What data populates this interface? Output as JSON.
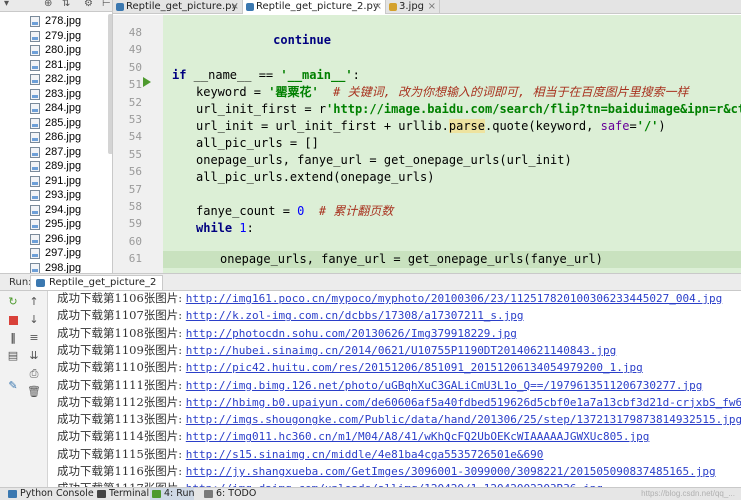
{
  "project": {
    "files": [
      "278.jpg",
      "279.jpg",
      "280.jpg",
      "281.jpg",
      "282.jpg",
      "283.jpg",
      "284.jpg",
      "285.jpg",
      "286.jpg",
      "287.jpg",
      "289.jpg",
      "291.jpg",
      "293.jpg",
      "294.jpg",
      "295.jpg",
      "296.jpg",
      "297.jpg",
      "298.jpg"
    ]
  },
  "tabs": [
    {
      "label": "Reptile_get_picture.py",
      "close": "×",
      "icon": "python-file-icon"
    },
    {
      "label": "Reptile_get_picture_2.py",
      "close": "×",
      "icon": "python-file-icon"
    },
    {
      "label": "3.jpg",
      "close": "×",
      "icon": "image-file-icon"
    }
  ],
  "editor": {
    "line_numbers": [
      "48",
      "49",
      "50",
      "51",
      "52",
      "53",
      "54",
      "55",
      "56",
      "57",
      "58",
      "59",
      "60",
      "61"
    ],
    "line_48": "continue",
    "line_51": {
      "kw1": "if",
      "text1": " __name__ == ",
      "str1": "'__main__'",
      "text2": ":"
    },
    "line_52": {
      "text1": "keyword = ",
      "str1": "'罂粟花'",
      "cmt1": "# 关键词, 改为你想输入的词即可, 相当于在百度图片里搜索一样"
    },
    "line_53": {
      "text1": "url_init_first = r",
      "str1": "'http://image.baidu.com/search/flip?tn=baiduimage&ipn=r&ct=2013265"
    },
    "line_54": {
      "text1": "url_init = url_init_first + urllib.",
      "hl1": "parse",
      "text2": ".quote(keyword, ",
      "prm1": "safe",
      "text3": "=",
      "str1": "'/'",
      "text4": ")"
    },
    "line_55": "all_pic_urls = []",
    "line_56": "onepage_urls, fanye_url = get_onepage_urls(url_init)",
    "line_57": "all_pic_urls.extend(onepage_urls)",
    "line_59": {
      "text1": "fanye_count = ",
      "num1": "0",
      "cmt1": "# 累计翻页数"
    },
    "line_60": {
      "kw1": "while",
      "text1": " ",
      "num1": "1",
      "text2": ":"
    },
    "line_61": "onepage_urls, fanye_url = get_onepage_urls(fanye_url)"
  },
  "run": {
    "label": "Run:",
    "tab": "Reptile_get_picture_2",
    "log": [
      {
        "text": "成功下载第1106张图片: ",
        "url": "http://img161.poco.cn/mypoco/myphoto/20100306/23/1125178201003062334450​27_004.jpg"
      },
      {
        "text": "成功下载第1107张图片: ",
        "url": "http://k.zol-img.com.cn/dcbbs/17308/a17307211_s.jpg"
      },
      {
        "text": "成功下载第1108张图片: ",
        "url": "http://photocdn.sohu.com/20130626/Img379918229.jpg"
      },
      {
        "text": "成功下载第1109张图片: ",
        "url": "http://hubei.sinaimg.cn/2014/0621/U10755P1190DT20140621140843.jpg"
      },
      {
        "text": "成功下载第1110张图片: ",
        "url": "http://pic42.huitu.com/res/20151206/851091_20151206134054979200_1.jpg"
      },
      {
        "text": "成功下载第1111张图片: ",
        "url": "http://img.bimg.126.net/photo/uGBqhXuC3GALiCmU3L1o_Q==/1979613511206730277.jpg"
      },
      {
        "text": "成功下载第1112张图片: ",
        "url": "http://hbimg.b0.upaiyun.com/de60606af5a40fdbed519626d5cbf0e1a7a13cbf3d21d-crjxbS_fw658"
      },
      {
        "text": "成功下载第1113张图片: ",
        "url": "http://imgs.shougongke.com/Public/data/hand/201306/25/step/1372131798738149​32515.jpg"
      },
      {
        "text": "成功下载第1114张图片: ",
        "url": "http://img011.hc360.cn/m1/M04/A8/41/wKhQcFQ2UbOEKcWIAAAAAJGWXUc805.jpg"
      },
      {
        "text": "成功下载第1115张图片: ",
        "url": "http://s15.sinaimg.cn/middle/4e81ba4cga5535726501e&690"
      },
      {
        "text": "成功下载第1116张图片: ",
        "url": "http://jy.shangxueba.com/GetImges/3096001-3099000/3098221/201505090837485165.jpg"
      },
      {
        "text": "成功下载第1117张图片: ",
        "url": "http://img.daimg.com/uploads/allimg/120420/1-12042002203R36.jpg"
      }
    ]
  },
  "bottom": {
    "python_console": "Python Console",
    "terminal": "Terminal",
    "run": "4: Run",
    "todo": "6: TODO",
    "watermark": "https://blog.csdn.net/qq_..."
  }
}
